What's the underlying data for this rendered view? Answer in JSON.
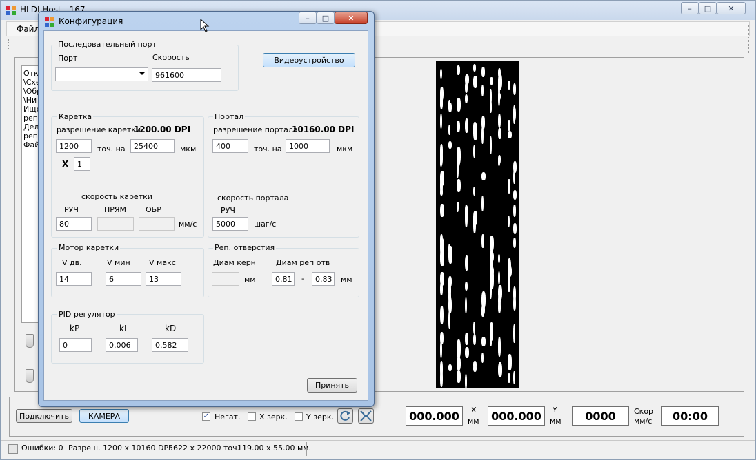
{
  "main_window": {
    "title": "HLDI Host - 167",
    "menu": [
      "Файл"
    ],
    "list_lines": [
      "Откр",
      "\\Схе",
      "\\Обр",
      "\\Ни",
      "Ище",
      "репп",
      "Дел",
      "репп",
      "Фай"
    ]
  },
  "dialog": {
    "title": "Конфигурация",
    "serial": {
      "title": "Последовательный порт",
      "port_label": "Порт",
      "port_value": "",
      "speed_label": "Скорость",
      "speed_value": "961600"
    },
    "video_button": "Видеоустройство",
    "carriage": {
      "title": "Каретка",
      "res_label": "разрешение каретки",
      "res_value": "1200.00 DPI",
      "points_value": "1200",
      "points_per_label": "точ. на",
      "um_value": "25400",
      "um_label": "мкм",
      "x_label": "X",
      "x_value": "1",
      "speed_title": "скорость каретки",
      "manual_label": "РУЧ",
      "forward_label": "ПРЯМ",
      "reverse_label": "ОБР",
      "manual_value": "80",
      "forward_value": "",
      "reverse_value": "",
      "unit_label": "мм/с"
    },
    "portal": {
      "title": "Портал",
      "res_label": "разрешение портала",
      "res_value": "10160.00 DPI",
      "points_value": "400",
      "points_per_label": "точ. на",
      "um_value": "1000",
      "um_label": "мкм",
      "speed_title": "скорость портала",
      "manual_label": "РУЧ",
      "manual_value": "5000",
      "unit_label": "шаг/с"
    },
    "motor": {
      "title": "Мотор каретки",
      "v_move_label": "V дв.",
      "v_min_label": "V мин",
      "v_max_label": "V макс",
      "v_move_value": "14",
      "v_min_value": "6",
      "v_max_value": "13"
    },
    "reg_holes": {
      "title": "Реп. отверстия",
      "core_label": "Диам керн",
      "core_value": "",
      "core_unit": "мм",
      "diam_label": "Диам реп отв",
      "diam_min": "0.81",
      "dash": "-",
      "diam_max": "0.83",
      "diam_unit": "мм"
    },
    "pid": {
      "title": "PID регулятор",
      "kp_label": "kP",
      "ki_label": "kI",
      "kd_label": "kD",
      "kp_value": "0",
      "ki_value": "0.006",
      "kd_value": "0.582"
    },
    "accept_button": "Принять"
  },
  "bottom": {
    "connect_button": "Подключить",
    "camera_button": "КАМЕРА",
    "negative_label": "Негат.",
    "negative_checked": "✓",
    "xmirror_label": "X зерк.",
    "ymirror_label": "Y зерк.",
    "x_readout": "000.000",
    "x_label": "X",
    "x_unit": "мм",
    "y_readout": "000.000",
    "y_label": "Y",
    "y_unit": "мм",
    "speed_readout": "0000",
    "speed_label": "Скор",
    "speed_unit": "мм/с",
    "time_readout": "00:00"
  },
  "status": {
    "errors": "Ошибки: 0",
    "resolution": "Разреш. 1200 x 10160 DPI",
    "points": "5622 x 22000 точ.",
    "size": "119.00 x 55.00 мм."
  },
  "colors": {
    "preview_bg": "#000000",
    "pad": "#ffffff",
    "dialog_frame": "#a9c4e6"
  }
}
